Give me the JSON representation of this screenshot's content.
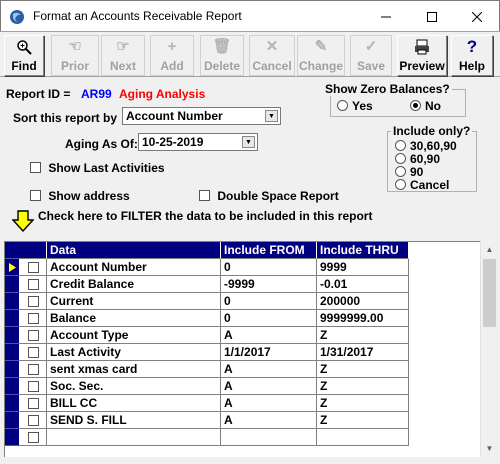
{
  "window": {
    "title": "Format an Accounts Receivable Report"
  },
  "toolbar": {
    "buttons": [
      {
        "label": "Find",
        "icon": "magnifier-icon",
        "glyph": "🔍",
        "enabled": true
      },
      {
        "label": "Prior",
        "icon": "prior-icon",
        "glyph": "☜",
        "enabled": false
      },
      {
        "label": "Next",
        "icon": "next-icon",
        "glyph": "☞",
        "enabled": false
      },
      {
        "label": "Add",
        "icon": "add-icon",
        "glyph": "+",
        "enabled": false
      },
      {
        "label": "Delete",
        "icon": "trash-icon",
        "glyph": "🗑",
        "enabled": false
      },
      {
        "label": "Cancel",
        "icon": "cancel-x-icon",
        "glyph": "✕",
        "enabled": false
      },
      {
        "label": "Change",
        "icon": "change-icon",
        "glyph": "✎",
        "enabled": false
      },
      {
        "label": "Save",
        "icon": "checkmark-icon",
        "glyph": "✓",
        "enabled": false
      },
      {
        "label": "Preview",
        "icon": "printer-preview-icon",
        "glyph": "🖶",
        "enabled": true
      },
      {
        "label": "Help",
        "icon": "help-icon",
        "glyph": "?",
        "enabled": true
      }
    ]
  },
  "form": {
    "report_id_label": "Report ID =",
    "report_id": "AR99",
    "report_name": "Aging Analysis",
    "sort_label": "Sort this report by",
    "sort_value": "Account Number",
    "aging_label": "Aging As Of:",
    "aging_value": "10-25-2019",
    "show_last_activities": "Show Last Activities",
    "show_address": "Show address",
    "double_space": "Double Space Report",
    "filter_text": "Check here to FILTER the data to be included in this report",
    "zero_balances": {
      "title": "Show Zero Balances?",
      "yes": "Yes",
      "no": "No",
      "selected": "No"
    },
    "include_only": {
      "title": "Include only?",
      "options": [
        "30,60,90",
        "60,90",
        "90",
        "Cancel"
      ]
    }
  },
  "grid": {
    "columns": [
      "Data",
      "Include FROM",
      "Include THRU"
    ],
    "rows": [
      {
        "data": "Account Number",
        "from": "0",
        "thru": "9999"
      },
      {
        "data": "Credit Balance",
        "from": "-9999",
        "thru": "-0.01"
      },
      {
        "data": "Current",
        "from": "0",
        "thru": "200000"
      },
      {
        "data": "Balance",
        "from": "0",
        "thru": "9999999.00"
      },
      {
        "data": "Account Type",
        "from": "A",
        "thru": "Z"
      },
      {
        "data": "Last Activity",
        "from": "1/1/2017",
        "thru": "1/31/2017"
      },
      {
        "data": "sent xmas card",
        "from": "A",
        "thru": "Z"
      },
      {
        "data": "Soc. Sec.",
        "from": "A",
        "thru": "Z"
      },
      {
        "data": "BILL CC",
        "from": "A",
        "thru": "Z"
      },
      {
        "data": "SEND S. FILL",
        "from": "A",
        "thru": "Z"
      },
      {
        "data": "",
        "from": "",
        "thru": ""
      }
    ]
  },
  "colors": {
    "grid_header": "#000080",
    "report_id": "#0000ff",
    "report_name": "#ff0000"
  }
}
